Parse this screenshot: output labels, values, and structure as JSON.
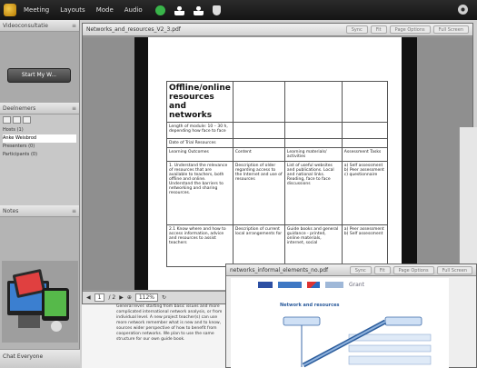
{
  "topbar": {
    "menu": [
      "Meeting",
      "Layouts",
      "Mode",
      "Audio"
    ]
  },
  "sidebar": {
    "broadcast_header": "Videoconsultatie",
    "start_button": "Start My W...",
    "participants_header": "Deelnemers",
    "participants_rows": [
      "Hosts (1)",
      "Anke Weisbrod",
      "Presenters (0)",
      "Participants (0)"
    ],
    "notes_header": "Notes",
    "chat_header": "Chat Everyone"
  },
  "docwin": {
    "title": "Networks_and_resources_V2_3.pdf",
    "buttons": [
      "Sync",
      "Fit",
      "Page Options",
      "Full Screen"
    ],
    "doc_title": "Offline/online resources and networks",
    "table": {
      "length_label": "Length of module: 10 – 30 h, depending how face to face",
      "date_label": "Date of Trial Resources",
      "headers": [
        "Learning Outcomes",
        "Content",
        "Learning materials/ activities",
        "Assessment Tasks"
      ],
      "row1": [
        "1. Understand the relevance of resources that are available to teachers, both offline and online. Understand the barriers to networking and sharing resources.",
        "Description of older regarding access to the Internet and use of resources",
        "List of useful websites and publications. Local and national links. Reading, face to face discussions",
        "a) Self assessment b) Peer assessment c) questionnaire"
      ],
      "row2": [
        "2.1 Know where and how to access information, advice and resources to assist teachers",
        "Description of current local arrangements for",
        "Guide books and general guidance - printed, online materials, internet, social",
        "a) Peer assessment b) Self assessment"
      ]
    },
    "toolbar": {
      "page": "1",
      "page_of": "/ 2",
      "zoom": "112%"
    }
  },
  "under_text": "General level: starting from basic issues and more complicated international network analysis, or from individual level. A new project teacher(s) can use more network remember what is new and to know, sources wider perspective of how to benefit from cooperation networks. We plan to use the same structure for our own guide book.",
  "win2": {
    "title": "networks_informal_elements_no.pdf",
    "buttons": [
      "Sync",
      "Fit",
      "Page Options",
      "Full Screen"
    ],
    "slide_title": "Network and resources",
    "slide_logo_text": "Grant"
  }
}
